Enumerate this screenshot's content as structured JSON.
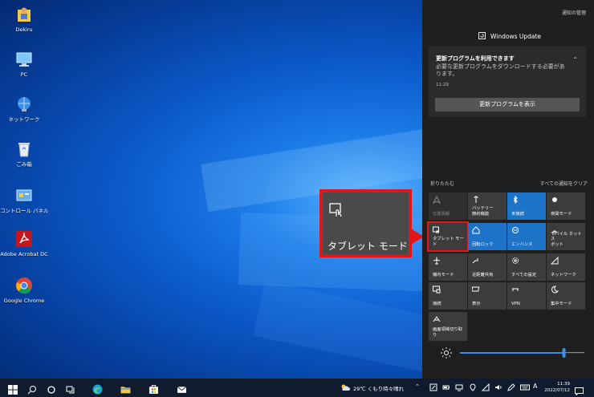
{
  "desktop": {
    "icons": [
      {
        "name": "user-folder-icon",
        "label": "Dekiru"
      },
      {
        "name": "pc-icon",
        "label": "PC"
      },
      {
        "name": "network-icon",
        "label": "ネットワーク"
      },
      {
        "name": "recycle-bin-icon",
        "label": "ごみ箱"
      },
      {
        "name": "control-panel-icon",
        "label": "コントロール パネル"
      },
      {
        "name": "acrobat-reader-icon",
        "label": "Adobe Acrobat DC"
      },
      {
        "name": "chrome-icon",
        "label": "Google Chrome"
      }
    ]
  },
  "callout": {
    "label": "タブレット モード",
    "icon": "tablet-mode-icon",
    "color": "#e1161b"
  },
  "action_center": {
    "manage": "通知の管理",
    "group_title": "Windows Update",
    "notification": {
      "title": "更新プログラムを利用できます",
      "body": "必要な更新プログラムをダウンロードする必要があります。",
      "time": "11:29",
      "button": "更新プログラムを表示"
    },
    "collapse": "折りたたむ",
    "clear_all": "すべての通知をクリア",
    "tiles": [
      {
        "label": "位置情報",
        "icon": "location-icon",
        "state": "disabled"
      },
      {
        "label": "バッテリー\n節約機能",
        "icon": "battery-saver-icon",
        "state": "off"
      },
      {
        "label": "未接続",
        "icon": "bluetooth-icon",
        "state": "on"
      },
      {
        "label": "夜間モード",
        "icon": "night-light-icon",
        "state": "off"
      },
      {
        "label": "タブレット モード",
        "icon": "tablet-mode-icon",
        "state": "off"
      },
      {
        "label": "回転ロック",
        "icon": "rotation-lock-icon",
        "state": "on"
      },
      {
        "label": "エンハンス",
        "icon": "focus-assist-icon",
        "state": "on"
      },
      {
        "label": "モバイル ホットス\nポット",
        "icon": "mobile-hotspot-icon",
        "state": "off"
      },
      {
        "label": "機内モード",
        "icon": "airplane-icon",
        "state": "off"
      },
      {
        "label": "近距離共有",
        "icon": "nearby-share-icon",
        "state": "off"
      },
      {
        "label": "すべての設定",
        "icon": "settings-icon",
        "state": "off"
      },
      {
        "label": "ネットワーク",
        "icon": "network-icon",
        "state": "off"
      },
      {
        "label": "接続",
        "icon": "connect-icon",
        "state": "off"
      },
      {
        "label": "表示",
        "icon": "project-icon",
        "state": "off"
      },
      {
        "label": "VPN",
        "icon": "vpn-icon",
        "state": "off"
      },
      {
        "label": "集中モード",
        "icon": "focus-icon",
        "state": "off"
      },
      {
        "label": "画面領域切り取\nり",
        "icon": "snip-icon",
        "state": "off"
      }
    ],
    "brightness": 0.82
  },
  "taskbar": {
    "weather": "29℃ くもり時々晴れ",
    "ime": "A",
    "time": "11:39",
    "date": "2022/07/12"
  }
}
